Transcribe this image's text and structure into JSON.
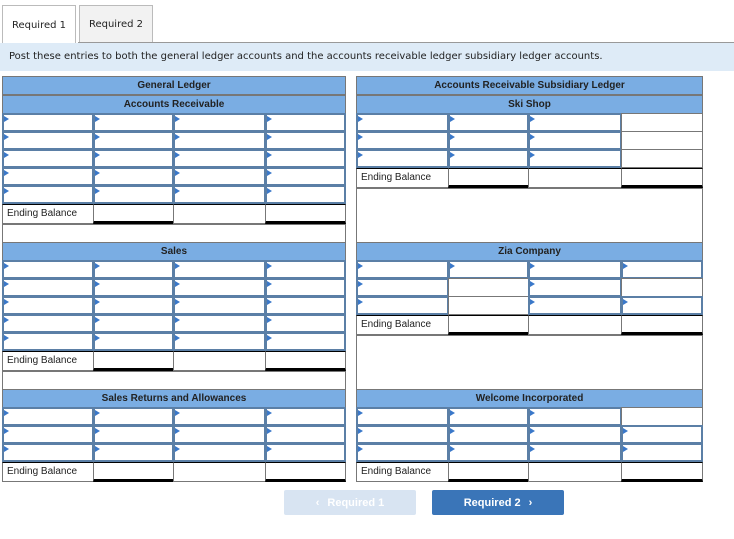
{
  "tabs": [
    {
      "label": "Required 1",
      "active": true
    },
    {
      "label": "Required 2",
      "active": false
    }
  ],
  "instruction": "Post these entries to both the general ledger accounts and the accounts receivable ledger subsidiary ledger accounts.",
  "general_ledger": {
    "title": "General Ledger",
    "accounts": [
      {
        "name": "Accounts Receivable",
        "rows": 5,
        "ending_balance_label": "Ending Balance"
      },
      {
        "name": "Sales",
        "rows": 5,
        "ending_balance_label": "Ending Balance"
      },
      {
        "name": "Sales Returns and Allowances",
        "rows": 3,
        "ending_balance_label": "Ending Balance"
      }
    ]
  },
  "subsidiary_ledger": {
    "title": "Accounts Receivable Subsidiary Ledger",
    "accounts": [
      {
        "name": "Ski Shop",
        "rows": 3,
        "ending_balance_label": "Ending Balance"
      },
      {
        "name": "Zia Company",
        "rows": 3,
        "ending_balance_label": "Ending Balance"
      },
      {
        "name": "Welcome Incorporated",
        "rows": 3,
        "ending_balance_label": "Ending Balance"
      }
    ]
  },
  "nav": {
    "prev_label": "Required 1",
    "next_label": "Required 2",
    "prev_icon": "chevron-left-icon",
    "next_icon": "chevron-right-icon"
  },
  "colors": {
    "header_blue": "#7aade3",
    "instruction_bg": "#deebf7",
    "next_button": "#3a75b8",
    "prev_button_disabled": "#d8e4f2"
  }
}
